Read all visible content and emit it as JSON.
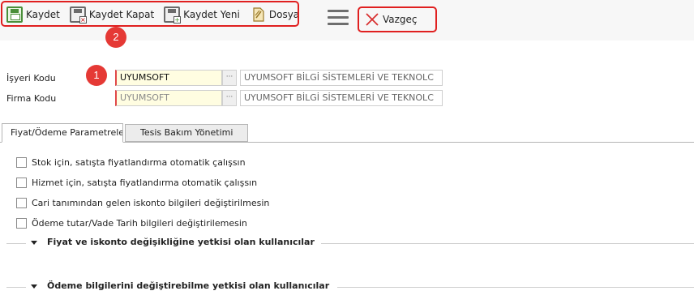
{
  "toolbar": {
    "save_label": "Kaydet",
    "save_close_label": "Kaydet Kapat",
    "save_new_label": "Kaydet Yeni",
    "file_label": "Dosya",
    "cancel_label": "Vazgeç"
  },
  "annotations": {
    "marker_1": "1",
    "marker_2": "2"
  },
  "form": {
    "workplace_label": "İşyeri Kodu",
    "workplace_code": "UYUMSOFT",
    "workplace_desc": "UYUMSOFT BİLGİ SİSTEMLERİ VE TEKNOLC",
    "company_label": "Firma Kodu",
    "company_code": "UYUMSOFT",
    "company_desc": "UYUMSOFT BİLGİ SİSTEMLERİ VE TEKNOLC",
    "lookup_glyph": "···"
  },
  "tabs": [
    {
      "label": "Fiyat/Ödeme Parametrele"
    },
    {
      "label": "Tesis Bakım Yönetimi"
    }
  ],
  "checkboxes": [
    {
      "label": "Stok için, satışta fiyatlandırma otomatik çalışsın"
    },
    {
      "label": "Hizmet için, satışta fiyatlandırma otomatik çalışsın"
    },
    {
      "label": "Cari tanımından gelen iskonto bilgileri değiştirilmesin"
    },
    {
      "label": "Ödeme tutar/Vade Tarih bilgileri değiştirilemesin"
    }
  ],
  "sections": [
    {
      "title": "Fiyat ve iskonto değişikliğine yetkisi olan kullanıcılar"
    },
    {
      "title": "Ödeme bilgilerini değiştirebilme yetkisi olan kullanıcılar"
    }
  ],
  "colors": {
    "highlight_red": "#e02020",
    "required_input_bg": "#fffde1"
  },
  "icons": [
    "save-icon",
    "save-close-icon",
    "save-new-icon",
    "file-icon",
    "menu-icon",
    "cancel-icon",
    "caret-down-icon"
  ]
}
